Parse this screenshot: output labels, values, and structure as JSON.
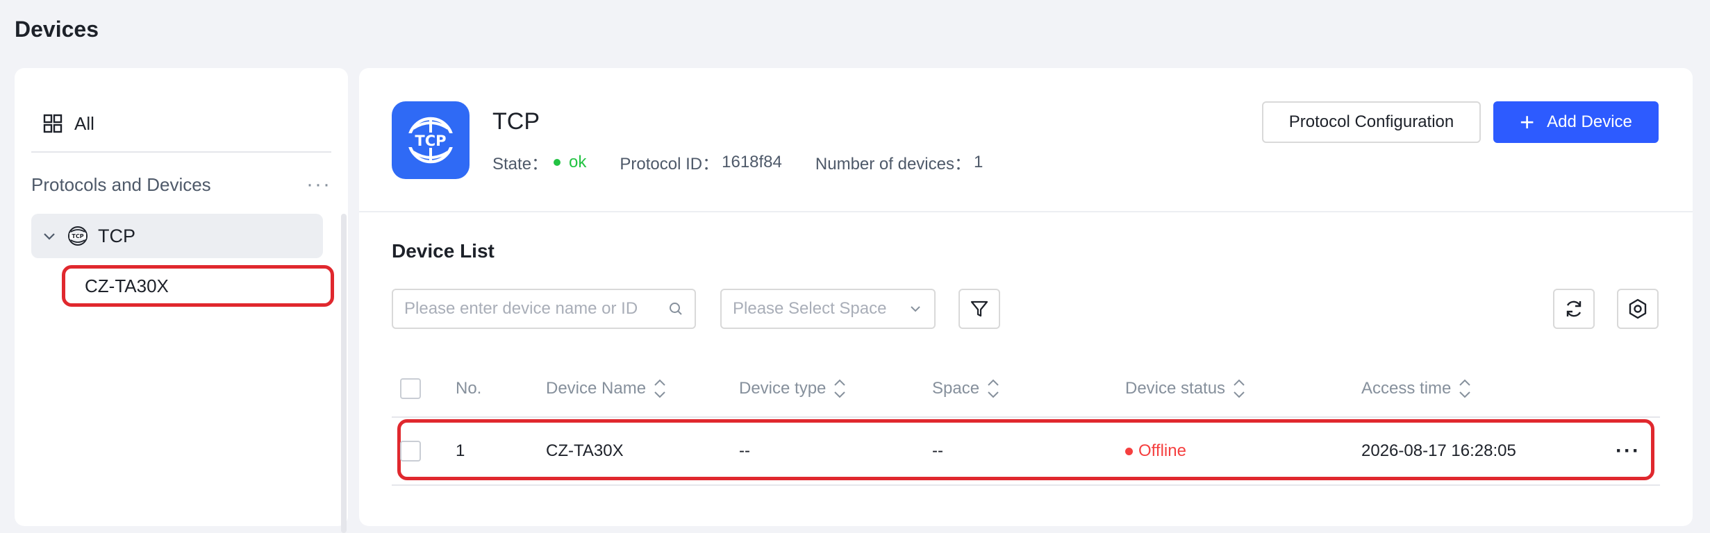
{
  "page": {
    "title": "Devices"
  },
  "sidebar": {
    "all_label": "All",
    "section_label": "Protocols and Devices",
    "more": "···",
    "protocol_item": {
      "label": "TCP"
    },
    "device_item": {
      "label": "CZ-TA30X"
    }
  },
  "protocol": {
    "logo_text": "TCP",
    "name": "TCP",
    "state_label": "State：",
    "state_value": "ok",
    "id_label": "Protocol ID：",
    "id_value": "1618f84",
    "count_label": "Number of devices：",
    "count_value": "1"
  },
  "actions": {
    "protocol_config": "Protocol Configuration",
    "add_device": "Add Device"
  },
  "device_list": {
    "title": "Device List",
    "search_placeholder": "Please enter device name or ID",
    "space_placeholder": "Please Select Space",
    "columns": [
      "No.",
      "Device Name",
      "Device type",
      "Space",
      "Device status",
      "Access time"
    ],
    "rows": [
      {
        "no": "1",
        "name": "CZ-TA30X",
        "type": "--",
        "space": "--",
        "status": "Offline",
        "access_time": "2026-08-17 16:28:05",
        "more": "···"
      }
    ]
  },
  "colors": {
    "primary": "#2d5bff",
    "ok": "#23c343",
    "offline": "#f53f3f",
    "highlight": "#e0282e"
  }
}
